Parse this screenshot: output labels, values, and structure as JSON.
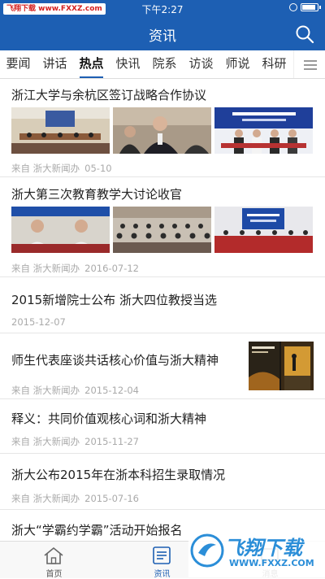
{
  "status_bar": {
    "watermark": "飞翔下载 www.FXXZ.com",
    "time": "下午2:27"
  },
  "nav": {
    "title": "资讯"
  },
  "tabs": [
    "要闻",
    "讲话",
    "热点",
    "快讯",
    "院系",
    "访谈",
    "师说",
    "科研"
  ],
  "active_tab": "热点",
  "articles": [
    {
      "title": "浙江大学与余杭区签订战略合作协议",
      "source": "来自 浙大新闻办",
      "date": "05-10"
    },
    {
      "title": "浙大第三次教育教学大讨论收官",
      "source": "来自 浙大新闻办",
      "date": "2016-07-12"
    },
    {
      "title": "2015新增院士公布 浙大四位教授当选",
      "source": "",
      "date": "2015-12-07"
    },
    {
      "title": "师生代表座谈共话核心价值与浙大精神",
      "source": "来自 浙大新闻办",
      "date": "2015-12-04"
    },
    {
      "title": "释义：共同价值观核心词和浙大精神",
      "source": "来自 浙大新闻办",
      "date": "2015-11-27"
    },
    {
      "title": "浙大公布2015年在浙本科招生录取情况",
      "source": "来自 浙大新闻办",
      "date": "2015-07-16"
    },
    {
      "title": "浙大“学霸约学霸”活动开始报名",
      "source": "",
      "date": ""
    }
  ],
  "bottom_tabs": [
    "首页",
    "资讯",
    "消息"
  ],
  "watermark_brand": {
    "name": "飞翔下载",
    "url": "WWW.FXXZ.COM"
  },
  "colors": {
    "primary": "#1d5fb3",
    "text": "#222222",
    "meta": "#aaaaaa"
  }
}
